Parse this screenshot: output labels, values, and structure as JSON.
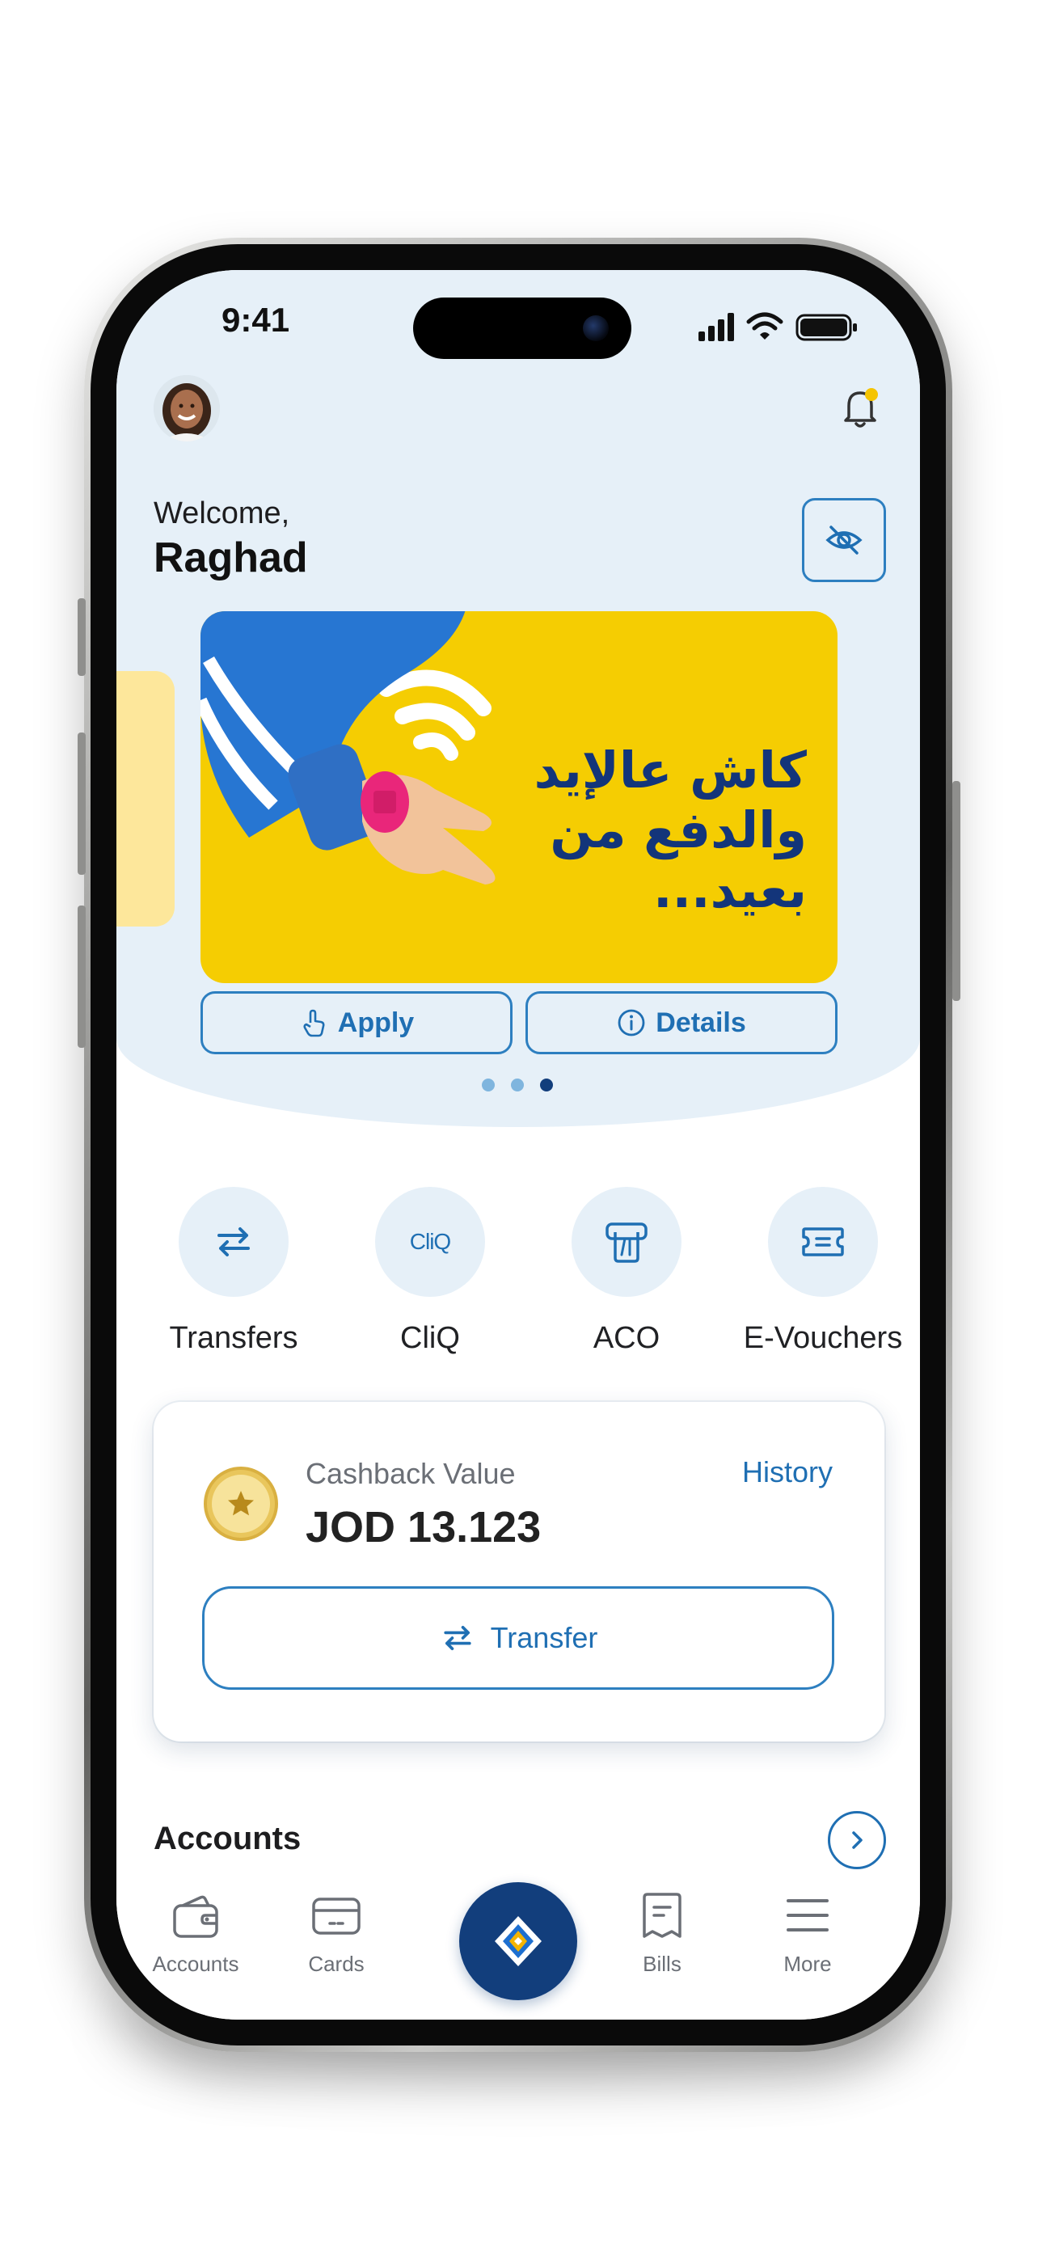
{
  "status_bar": {
    "time": "9:41"
  },
  "header": {
    "welcome": "Welcome,",
    "user_name": "Raghad"
  },
  "banner": {
    "text_lines": [
      "كاش عالإيد",
      "والدفع من",
      "بعيد..."
    ],
    "apply_label": "Apply",
    "details_label": "Details",
    "slide_count": 3,
    "active_slide": 3
  },
  "quick_actions": [
    {
      "label": "Transfers",
      "icon": "transfer-arrows-icon"
    },
    {
      "label": "CliQ",
      "icon": "cliq-logo-icon"
    },
    {
      "label": "ACO",
      "icon": "atm-icon"
    },
    {
      "label": "E-Vouchers",
      "icon": "voucher-icon"
    }
  ],
  "cashback": {
    "label": "Cashback Value",
    "value": "JOD 13.123",
    "history_label": "History",
    "transfer_label": "Transfer"
  },
  "accounts_section": {
    "title": "Accounts"
  },
  "bottom_nav": {
    "items": [
      {
        "label": "Accounts",
        "icon": "wallet-icon"
      },
      {
        "label": "Cards",
        "icon": "card-icon"
      },
      {
        "label": "Bills",
        "icon": "receipt-icon"
      },
      {
        "label": "More",
        "icon": "menu-icon"
      }
    ],
    "center_icon": "bank-logo-icon"
  },
  "colors": {
    "primary_blue": "#1f6fb3",
    "navy": "#123e7c",
    "banner_yellow": "#f5cd02",
    "light_bg": "#e6f0f8"
  }
}
